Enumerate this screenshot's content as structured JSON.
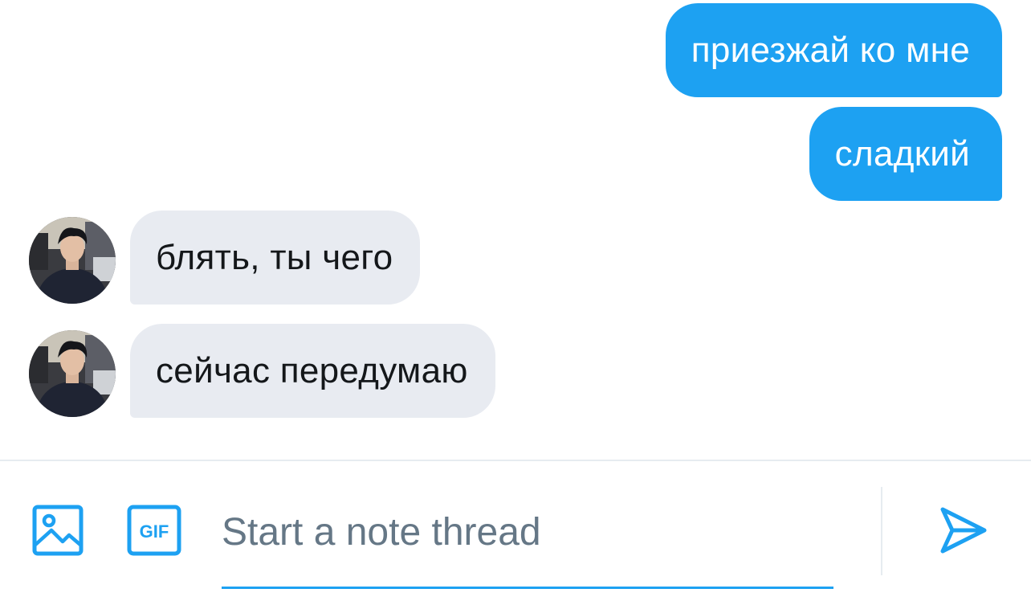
{
  "messages": [
    {
      "direction": "outgoing",
      "text": "приезжай ко мне"
    },
    {
      "direction": "outgoing",
      "text": "сладкий"
    },
    {
      "direction": "incoming",
      "text": "блять, ты чего"
    },
    {
      "direction": "incoming",
      "text": "сейчас передумаю"
    }
  ],
  "composer": {
    "placeholder": "Start a note thread",
    "image_icon": "image-icon",
    "gif_icon": "gif-icon",
    "gif_label": "GIF",
    "send_icon": "send-icon"
  },
  "colors": {
    "accent": "#1da1f2",
    "incoming_bubble": "#e8ebf1",
    "placeholder": "#657786",
    "text": "#14171a"
  }
}
